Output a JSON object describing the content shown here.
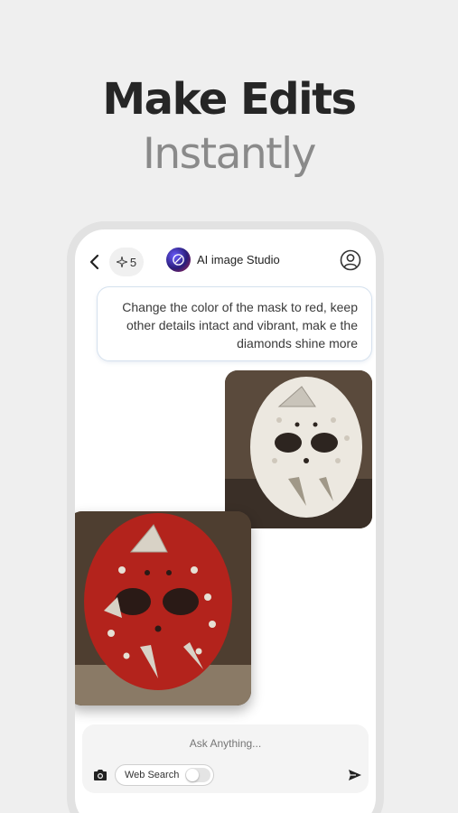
{
  "headline": {
    "line1": "Make Edits",
    "line2": "Instantly"
  },
  "topbar": {
    "back_icon": "chevron-left-icon",
    "credits_icon": "sparkle-icon",
    "credits_count": "5",
    "logo_icon": "ai-logo-icon",
    "app_title": "AI image Studio",
    "profile_icon": "user-circle-icon"
  },
  "chat": {
    "user_message": "Change the color of the mask to red, keep other details intact and vibrant, mak e the diamonds shine more",
    "images": [
      {
        "description_key": "original",
        "mask_color": "#ece8e0"
      },
      {
        "description_key": "edited",
        "mask_color": "#b3231c"
      }
    ]
  },
  "composer": {
    "placeholder": "Ask Anything...",
    "camera_icon": "camera-icon",
    "web_search_label": "Web Search",
    "web_search_enabled": false,
    "send_icon": "send-icon"
  },
  "colors": {
    "background": "#efefef",
    "headline_dark": "#262626",
    "headline_light": "#8a8a8a",
    "bubble_border": "#d5e1ee"
  }
}
